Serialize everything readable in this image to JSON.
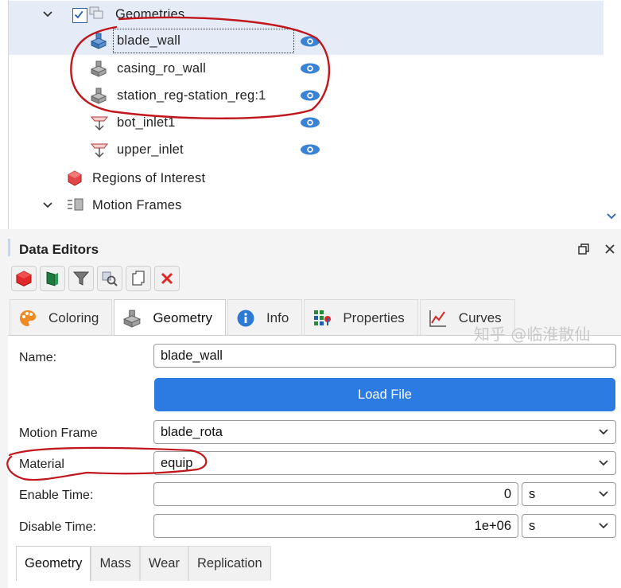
{
  "tree": {
    "geometries_label": "Geometries",
    "items": [
      {
        "label": "blade_wall"
      },
      {
        "label": "casing_ro_wall"
      },
      {
        "label": "station_reg-station_reg:1"
      },
      {
        "label": "bot_inlet1"
      },
      {
        "label": "upper_inlet"
      }
    ],
    "regions_label": "Regions of Interest",
    "motion_frames_label": "Motion Frames"
  },
  "editor": {
    "title": "Data Editors",
    "tabs": [
      {
        "label": "Coloring",
        "icon": "palette-icon"
      },
      {
        "label": "Geometry",
        "icon": "geometry-icon"
      },
      {
        "label": "Info",
        "icon": "info-icon"
      },
      {
        "label": "Properties",
        "icon": "properties-icon"
      },
      {
        "label": "Curves",
        "icon": "curves-icon"
      }
    ],
    "active_tab": "Geometry",
    "form": {
      "name_label": "Name:",
      "name_value": "blade_wall",
      "load_file_label": "Load File",
      "motion_frame_label": "Motion Frame",
      "motion_frame_value": "blade_rota",
      "material_label": "Material",
      "material_value": "equip",
      "enable_time_label": "Enable Time:",
      "enable_time_value": "0",
      "enable_time_unit": "s",
      "disable_time_label": "Disable Time:",
      "disable_time_value": "1e+06",
      "disable_time_unit": "s"
    },
    "subtabs": [
      {
        "label": "Geometry"
      },
      {
        "label": "Mass"
      },
      {
        "label": "Wear"
      },
      {
        "label": "Replication"
      }
    ]
  },
  "watermark": "知乎 @临淮散仙",
  "colors": {
    "accent": "#2b7be3",
    "annotation": "#c0161c",
    "selection": "#e5ecf7"
  }
}
